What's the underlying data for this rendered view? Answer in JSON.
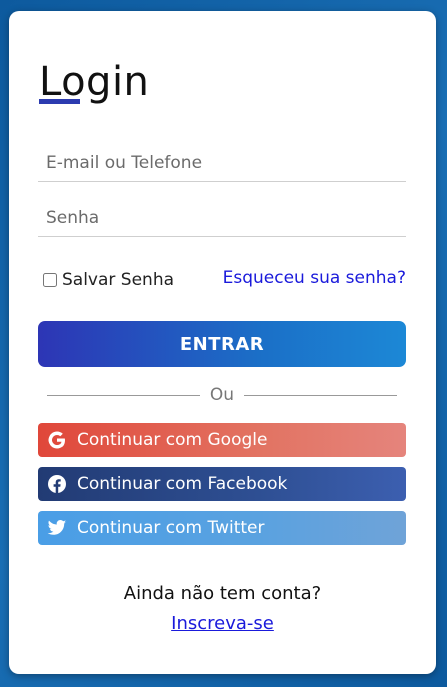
{
  "form": {
    "title": "Login",
    "email_placeholder": "E-mail ou Telefone",
    "password_placeholder": "Senha",
    "remember_label": "Salvar Senha",
    "forgot_label": "Esqueceu sua senha?",
    "submit_label": "ENTRAR",
    "divider_label": "Ou"
  },
  "social": {
    "google_label": "Continuar com Google",
    "google_icon": "google-icon",
    "facebook_label": "Continuar com Facebook",
    "facebook_icon": "facebook-icon",
    "twitter_label": "Continuar com Twitter",
    "twitter_icon": "twitter-icon"
  },
  "footer": {
    "question": "Ainda não tem conta?",
    "signup_label": "Inscreva-se"
  },
  "colors": {
    "accent": "#2c3bb0",
    "link": "#1a1adb",
    "google": "#e0473a",
    "facebook": "#223b74",
    "twitter": "#4a9ee6",
    "background": "#0d5a9e"
  }
}
